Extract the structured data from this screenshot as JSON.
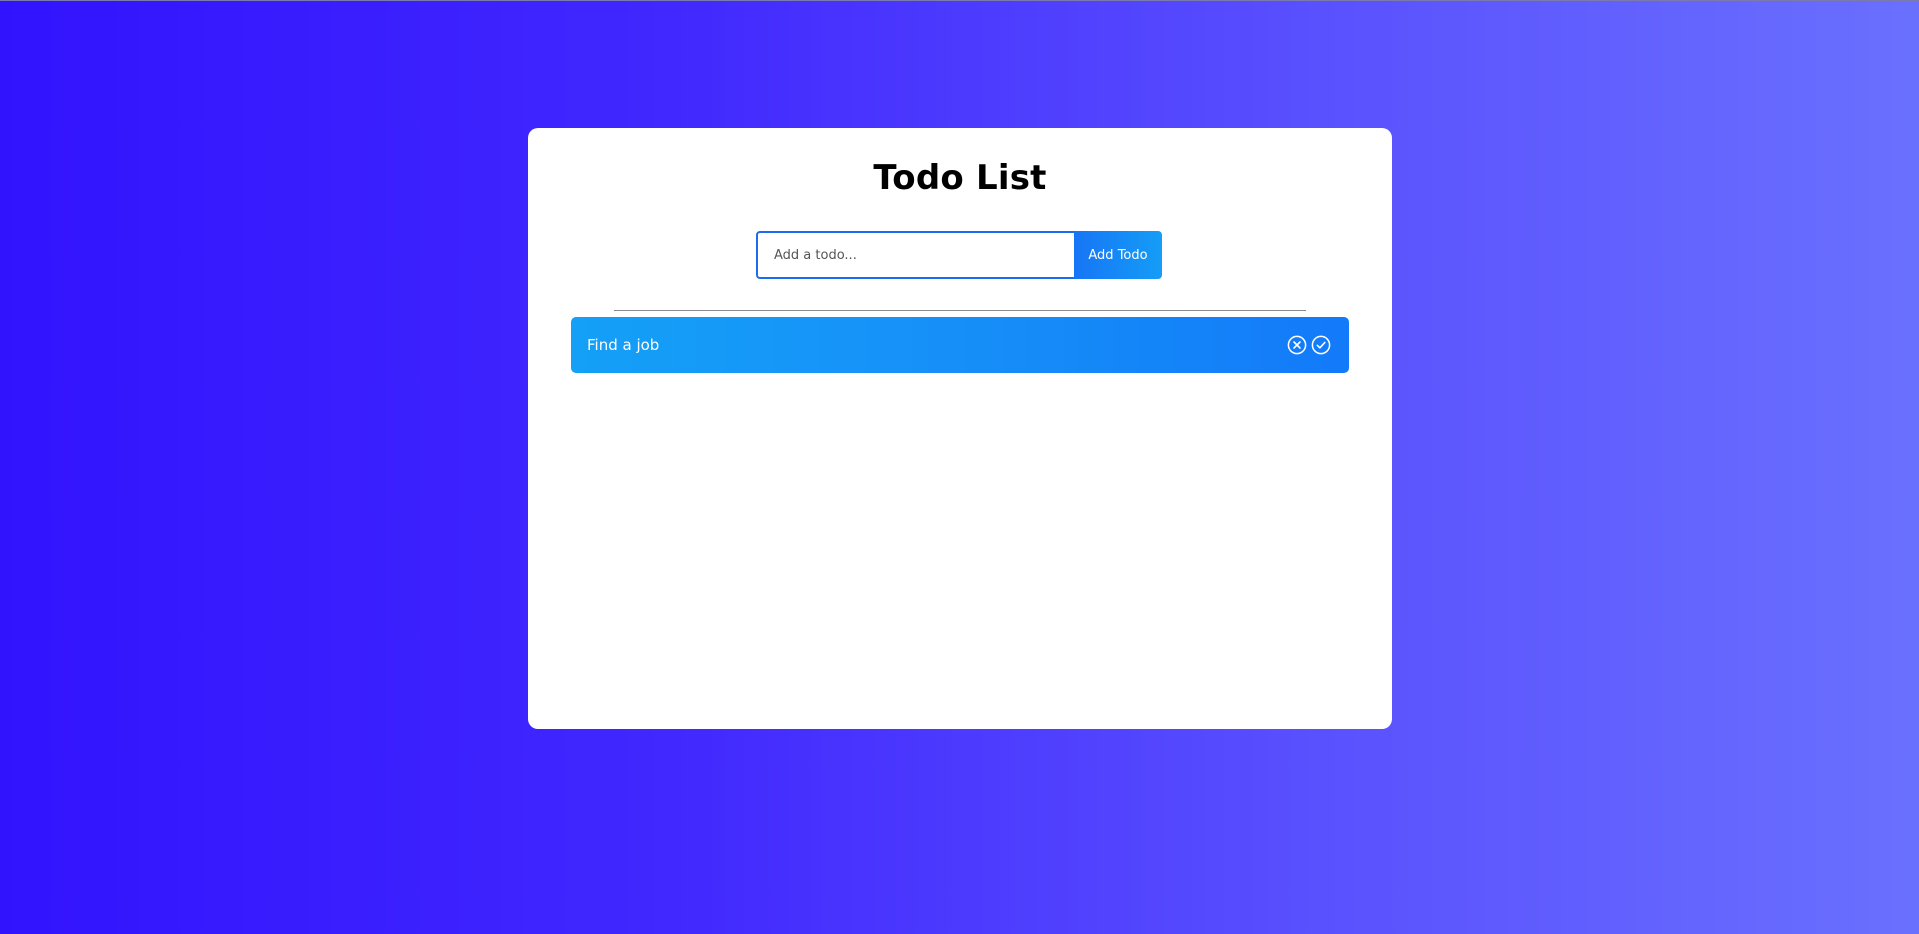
{
  "app": {
    "title": "Todo List"
  },
  "form": {
    "input_value": "",
    "input_placeholder": "Add a todo...",
    "add_label": "Add Todo"
  },
  "todos": [
    {
      "text": "Find a job",
      "actions": [
        "close-circle-icon",
        "check-circle-icon"
      ]
    }
  ],
  "colors": {
    "background_start": "#3213fe",
    "background_end": "#6a70fe",
    "card": "#ffffff",
    "accent": "#1675f5",
    "todo_start": "#14a0f7",
    "todo_end": "#137af9"
  }
}
